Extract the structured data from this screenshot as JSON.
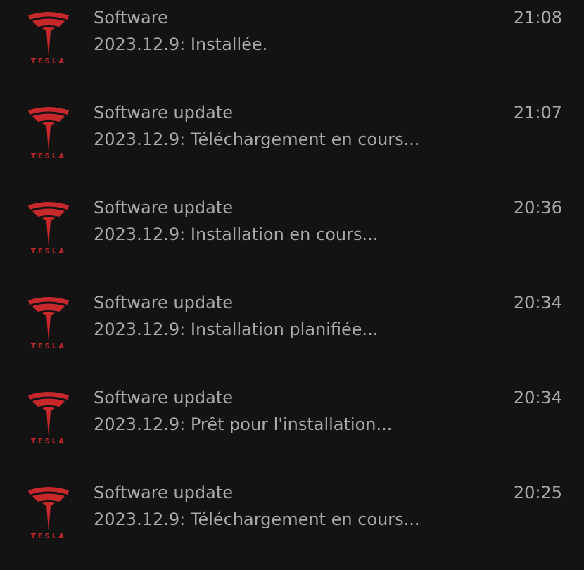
{
  "brand": {
    "logo_text": "TESLA",
    "accent_color": "#c7282b"
  },
  "notifications": [
    {
      "title": "Software",
      "status": "2023.12.9: Installée.",
      "time": "21:08"
    },
    {
      "title": "Software update",
      "status": "2023.12.9: Téléchargement en cours...",
      "time": "21:07"
    },
    {
      "title": "Software update",
      "status": "2023.12.9: Installation en cours...",
      "time": "20:36"
    },
    {
      "title": "Software update",
      "status": "2023.12.9: Installation planifiée...",
      "time": "20:34"
    },
    {
      "title": "Software update",
      "status": "2023.12.9: Prêt pour l'installation...",
      "time": "20:34"
    },
    {
      "title": "Software update",
      "status": "2023.12.9: Téléchargement en cours...",
      "time": "20:25"
    }
  ]
}
